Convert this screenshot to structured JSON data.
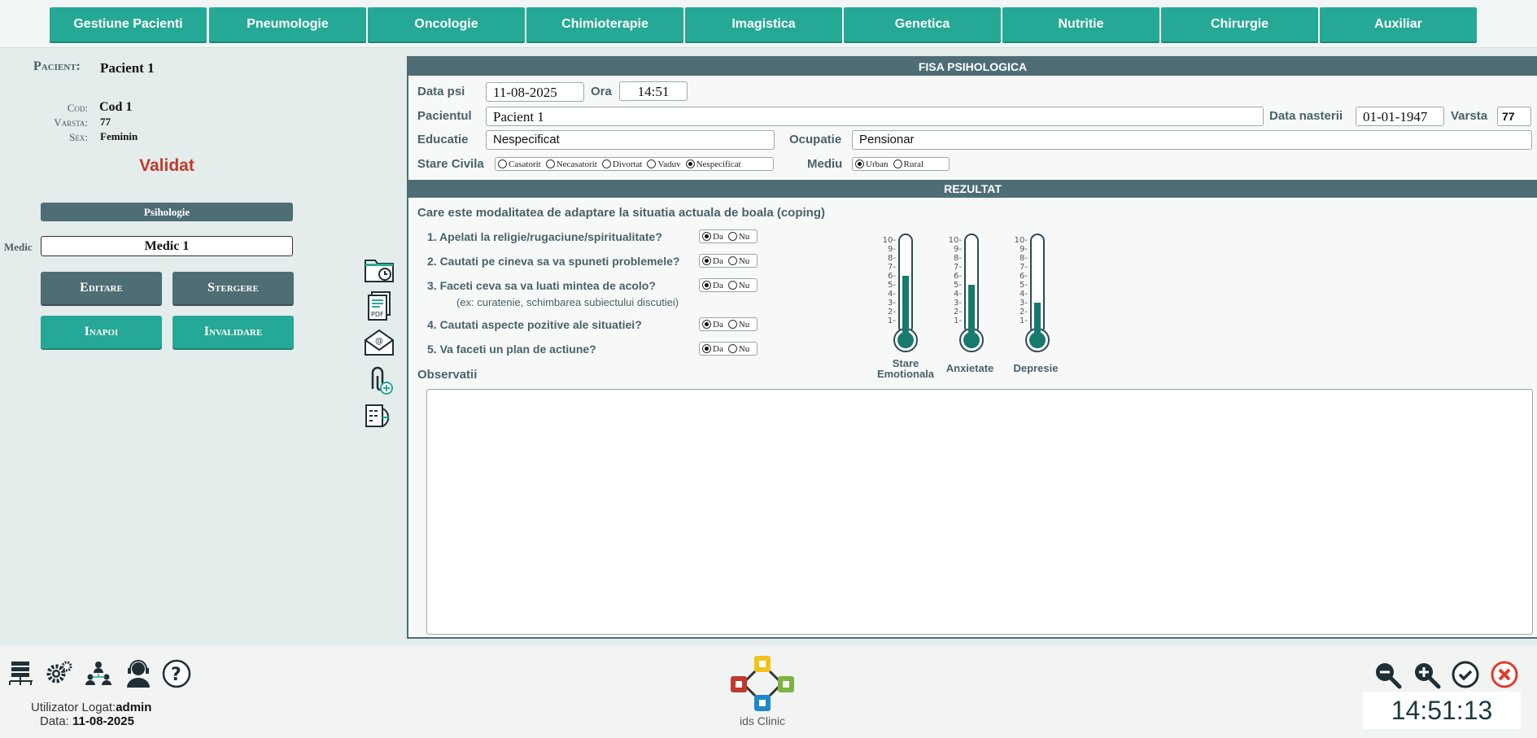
{
  "nav_tabs": [
    "Gestiune Pacienti",
    "Pneumologie",
    "Oncologie",
    "Chimioterapie",
    "Imagistica",
    "Genetica",
    "Nutritie",
    "Chirurgie",
    "Auxiliar"
  ],
  "patient": {
    "pacient_label": "Pacient:",
    "pacient_value": "Pacient 1",
    "cod_label": "Cod:",
    "cod_value": "Cod 1",
    "varsta_label": "Varsta:",
    "varsta_value": "77",
    "sex_label": "Sex:",
    "sex_value": "Feminin",
    "status": "Validat"
  },
  "section_badge": "Psihologie",
  "medic_label": "Medic",
  "medic_value": "Medic 1",
  "buttons": {
    "editare": "Editare",
    "stergere": "Stergere",
    "inapoi": "Inapoi",
    "invalidare": "Invalidare"
  },
  "fisa": {
    "header": "FISA PSIHOLOGICA",
    "data_psi_label": "Data psi",
    "data_psi_value": "11-08-2025",
    "ora_label": "Ora",
    "ora_value": "14:51",
    "pacientul_label": "Pacientul",
    "pacientul_value": "Pacient 1",
    "data_nasterii_label": "Data nasterii",
    "data_nasterii_value": "01-01-1947",
    "varsta_label": "Varsta",
    "varsta_value": "77",
    "educatie_label": "Educatie",
    "educatie_value": "Nespecificat",
    "ocupatie_label": "Ocupatie",
    "ocupatie_value": "Pensionar",
    "stare_civila_label": "Stare Civila",
    "stare_civila_options": [
      "Casatorit",
      "Necasatorit",
      "Divortat",
      "Vaduv",
      "Nespecificat"
    ],
    "stare_civila_selected": "Nespecificat",
    "mediu_label": "Mediu",
    "mediu_options": [
      "Urban",
      "Rural"
    ],
    "mediu_selected": "Urban"
  },
  "rezultat": {
    "header": "REZULTAT",
    "question_title": "Care este modalitatea de adaptare la situatia actuala de boala (coping)",
    "questions": [
      "1. Apelati la religie/rugaciune/spiritualitate?",
      "2. Cautati pe cineva sa va spuneti problemele?",
      "3. Faceti ceva sa va luati mintea de acolo?",
      "4. Cautati aspecte pozitive ale situatiei?",
      "5. Va faceti un plan de actiune?"
    ],
    "question3_hint": "(ex: curatenie, schimbarea subiectului discutiei)",
    "yes_label": "Da",
    "no_label": "Nu",
    "answers": [
      "Da",
      "Da",
      "Da",
      "Da",
      "Da"
    ],
    "observatii_label": "Observatii",
    "observatii_value": "",
    "scale_ticks": [
      "10-",
      "9-",
      "8-",
      "7-",
      "6-",
      "5-",
      "4-",
      "3-",
      "2-",
      "1-"
    ],
    "thermometers": [
      {
        "label_line1": "Stare",
        "label_line2": "Emotionala",
        "level": 6,
        "max": 10
      },
      {
        "label_line1": "Anxietate",
        "label_line2": "",
        "level": 5,
        "max": 10
      },
      {
        "label_line1": "Depresie",
        "label_line2": "",
        "level": 3,
        "max": 10
      }
    ]
  },
  "footer": {
    "user_label": "Utilizator Logat:",
    "user_value": "admin",
    "date_label": "Data:",
    "date_value": "11-08-2025",
    "logo_text": "ids Clinic",
    "clock": "14:51:13"
  },
  "colors": {
    "accent": "#26a896",
    "dark": "#4e6d75",
    "status": "#c0392b"
  }
}
